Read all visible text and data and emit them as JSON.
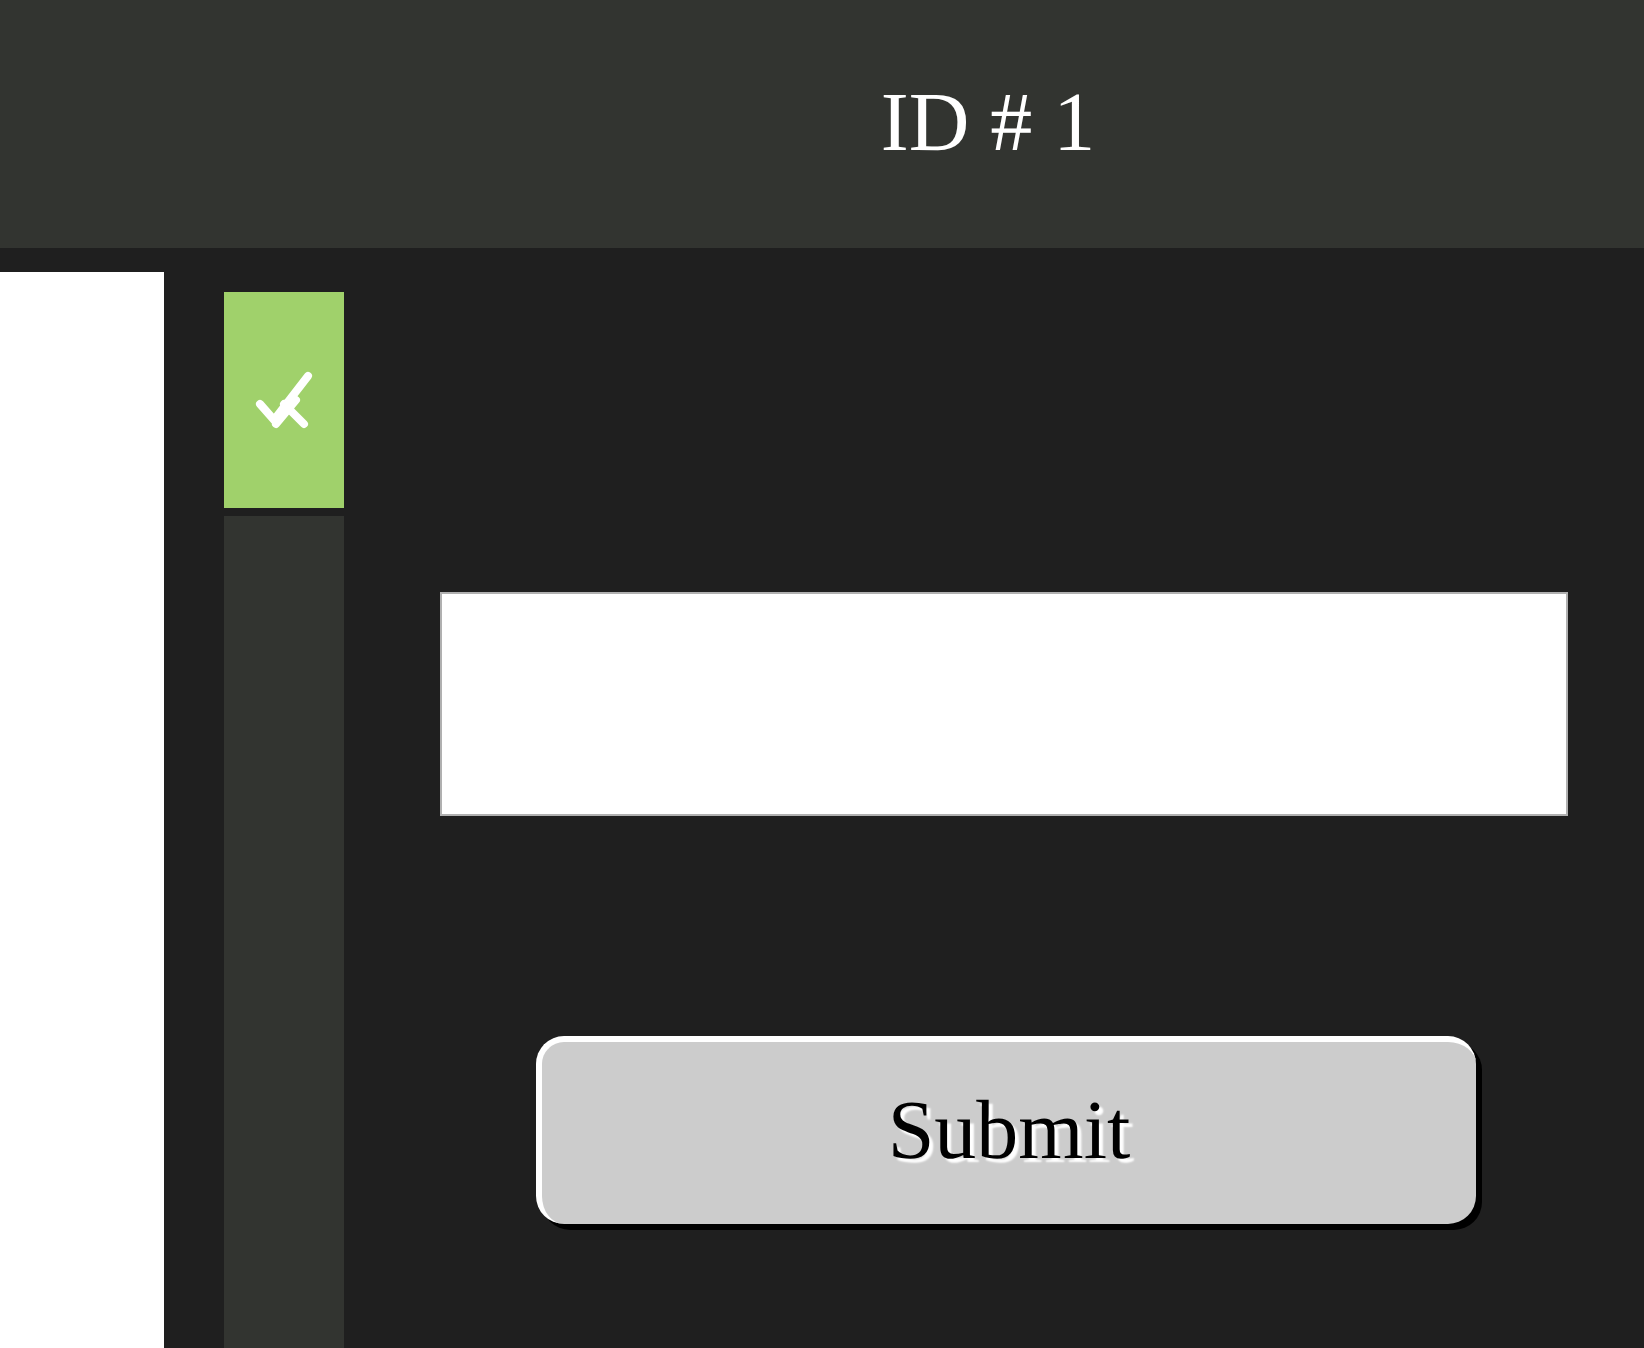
{
  "header": {
    "title": "ID # 1"
  },
  "submit_button": {
    "label": "Submit"
  }
}
